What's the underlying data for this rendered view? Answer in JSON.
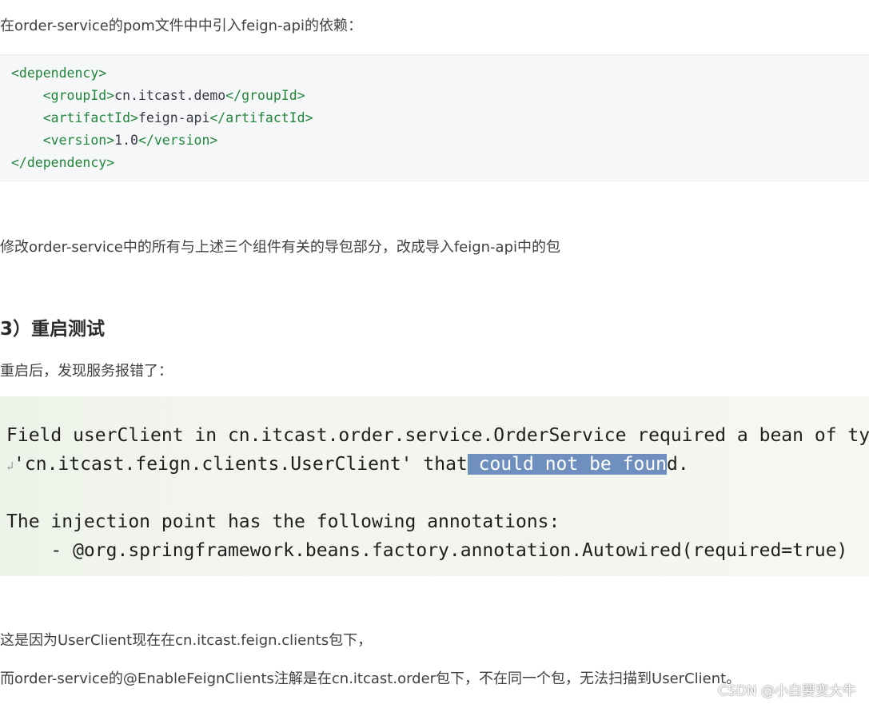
{
  "intro_text": "在order-service的pom文件中中引入feign-api的依赖：",
  "pom_code": {
    "line1": "<dependency>",
    "line2_open": "<groupId>",
    "line2_value": "cn.itcast.demo",
    "line2_close": "</groupId>",
    "line3_open": "<artifactId>",
    "line3_value": "feign-api",
    "line3_close": "</artifactId>",
    "line4_open": "<version>",
    "line4_value": "1.0",
    "line4_close": "</version>",
    "line5": "</dependency>"
  },
  "modify_text": "修改order-service中的所有与上述三个组件有关的导包部分，改成导入feign-api中的包",
  "section_heading": "3）重启测试",
  "restart_text": "重启后，发现服务报错了：",
  "error_output": {
    "line1": "Field userClient in cn.itcast.order.service.OrderService required a bean of type",
    "line2_start": "'cn.itcast.feign.clients.UserClient' that",
    "line2_selected": " could not be foun",
    "line2_end": "d.",
    "line3": "The injection point has the following annotations:",
    "line4": "    - @org.springframework.beans.factory.annotation.Autowired(required=true)"
  },
  "reason_text_1": "这是因为UserClient现在在cn.itcast.feign.clients包下，",
  "reason_text_2": "而order-service的@EnableFeignClients注解是在cn.itcast.order包下，不在同一个包，无法扫描到UserClient。",
  "watermark": "CSDN @小白要变大牛"
}
